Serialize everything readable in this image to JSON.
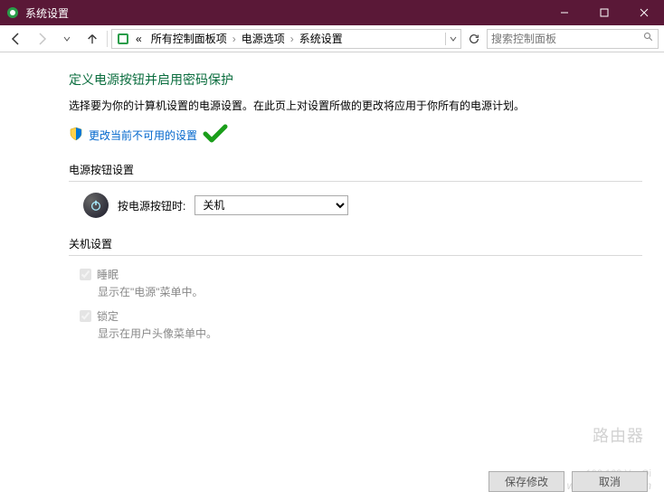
{
  "titlebar": {
    "title": "系统设置"
  },
  "address": {
    "breadcrumb_prefix": "«",
    "crumb1": "所有控制面板项",
    "crumb2": "电源选项",
    "crumb3": "系统设置"
  },
  "search": {
    "placeholder": "搜索控制面板"
  },
  "page": {
    "heading": "定义电源按钮并启用密码保护",
    "description": "选择要为你的计算机设置的电源设置。在此页上对设置所做的更改将应用于你所有的电源计划。",
    "change_link": "更改当前不可用的设置"
  },
  "sections": {
    "power_button": {
      "title": "电源按钮设置",
      "label": "按电源按钮时:",
      "selected": "关机"
    },
    "shutdown": {
      "title": "关机设置",
      "sleep": {
        "label": "睡眠",
        "sub": "显示在\"电源\"菜单中。"
      },
      "lock": {
        "label": "锁定",
        "sub": "显示在用户头像菜单中。"
      }
    }
  },
  "buttons": {
    "save": "保存修改",
    "cancel": "取消"
  },
  "watermark": {
    "text": "路由器",
    "url": "www.cfan.com.cn",
    "url2": "192.168.YouQi"
  }
}
